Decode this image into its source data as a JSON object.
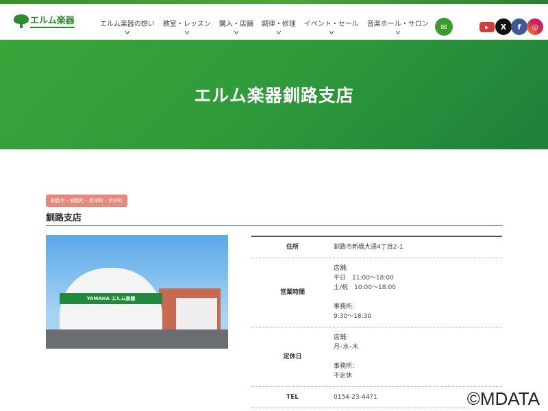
{
  "header": {
    "logo_text": "エルム楽器",
    "nav": [
      "エルム楽器の想い",
      "教室・レッスン",
      "購入・店舗",
      "調律・修理",
      "イベント・セール",
      "音楽ホール・サロン"
    ],
    "social": {
      "youtube": "▶",
      "x": "X",
      "facebook": "f",
      "instagram": "◎"
    }
  },
  "hero": {
    "title": "エルム楽器釧路支店"
  },
  "store": {
    "area_tag": "釧路市・釧路町・厚岸町・浜中町",
    "name": "釧路支店",
    "photo_sign": "YAMAHA エルム楽器",
    "rows": [
      {
        "label": "住所",
        "lines": [
          "釧路市新橋大通4丁目2-1"
        ]
      },
      {
        "label": "営業時間",
        "lines": [
          "店舗:",
          "平日　11:00〜18:00",
          "土/祝　10:00〜18:00",
          "",
          "事務所:",
          "9:30〜18:30"
        ]
      },
      {
        "label": "定休日",
        "lines": [
          "店舗:",
          "月･水･木",
          "",
          "事務所:",
          "不定休"
        ]
      },
      {
        "label": "TEL",
        "lines": [
          "0154-23-4471"
        ]
      }
    ]
  },
  "watermark": "©MDATA"
}
